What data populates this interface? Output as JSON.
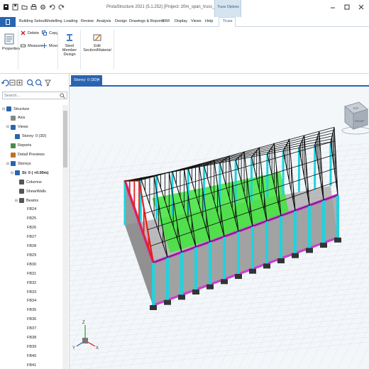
{
  "window": {
    "title": "ProtaStructure 2021 (5.1.252) [Project: 20m_span_truss_design]",
    "context_tab_group": "Truss Options"
  },
  "ribbon": {
    "tabs": [
      {
        "label": "Building Setout"
      },
      {
        "label": "Modelling"
      },
      {
        "label": "Loading"
      },
      {
        "label": "Review"
      },
      {
        "label": "Analysis"
      },
      {
        "label": "Design"
      },
      {
        "label": "Drawings & Reports"
      },
      {
        "label": "BIM"
      },
      {
        "label": "Display"
      },
      {
        "label": "Views"
      },
      {
        "label": "Help"
      },
      {
        "label": "Truss"
      }
    ],
    "active_tab": "Truss",
    "buttons": {
      "properties": "Properties",
      "delete": "Delete",
      "copy": "Copy",
      "measure": "Measure",
      "move": "Move",
      "steel_member_design": "Steel Member Design",
      "edit_section": "Edit Section/Material"
    }
  },
  "left_panel": {
    "search_placeholder": "Search...",
    "tree": [
      {
        "label": "Structure",
        "level": 0,
        "toggle": "⊟",
        "icon": "structure-icon"
      },
      {
        "label": "Axis",
        "level": 1,
        "toggle": "",
        "icon": "axis-icon"
      },
      {
        "label": "Views",
        "level": 1,
        "toggle": "⊟",
        "icon": "views-icon"
      },
      {
        "label": "Storey: 0 (3D)",
        "level": 2,
        "toggle": "",
        "icon": "storey-view-icon"
      },
      {
        "label": "Reports",
        "level": 1,
        "toggle": "",
        "icon": "reports-icon"
      },
      {
        "label": "Detail Previews",
        "level": 1,
        "toggle": "",
        "icon": "detail-icon"
      },
      {
        "label": "Storeys",
        "level": 1,
        "toggle": "⊟",
        "icon": "storeys-icon"
      },
      {
        "label": "St: 0 ( +0.00m)",
        "level": 2,
        "toggle": "⊟",
        "icon": "storey-icon",
        "bold": true
      },
      {
        "label": "Columns",
        "level": 3,
        "toggle": "",
        "icon": "columns-icon"
      },
      {
        "label": "ShearWalls",
        "level": 3,
        "toggle": "",
        "icon": "shearwalls-icon"
      },
      {
        "label": "Beams",
        "level": 3,
        "toggle": "⊟",
        "icon": "beams-icon"
      },
      {
        "label": "FB24",
        "level": 4
      },
      {
        "label": "FB25",
        "level": 4
      },
      {
        "label": "FB26",
        "level": 4
      },
      {
        "label": "FB27",
        "level": 4
      },
      {
        "label": "FB28",
        "level": 4
      },
      {
        "label": "FB29",
        "level": 4
      },
      {
        "label": "FB30",
        "level": 4
      },
      {
        "label": "FB31",
        "level": 4
      },
      {
        "label": "FB32",
        "level": 4
      },
      {
        "label": "FB33",
        "level": 4
      },
      {
        "label": "FB34",
        "level": 4
      },
      {
        "label": "FB35",
        "level": 4
      },
      {
        "label": "FB36",
        "level": 4
      },
      {
        "label": "FB37",
        "level": 4
      },
      {
        "label": "FB38",
        "level": 4
      },
      {
        "label": "FB39",
        "level": 4
      },
      {
        "label": "FB40",
        "level": 4
      },
      {
        "label": "FB41",
        "level": 4
      }
    ]
  },
  "document": {
    "tab_label": "Storey: 0 (3D)",
    "viewcube_faces": {
      "top": "TOP",
      "front": "FRONT"
    },
    "axis_labels": {
      "z": "Z",
      "x": "X",
      "y": "Y"
    }
  },
  "colors": {
    "accent": "#2a64b0",
    "truss_selected": "#e0231c",
    "truss": "#111111",
    "columns": "#1fd3de",
    "slab": "#3ee53a",
    "beams": "#d23bd6",
    "walls": "#8a8a8a"
  }
}
